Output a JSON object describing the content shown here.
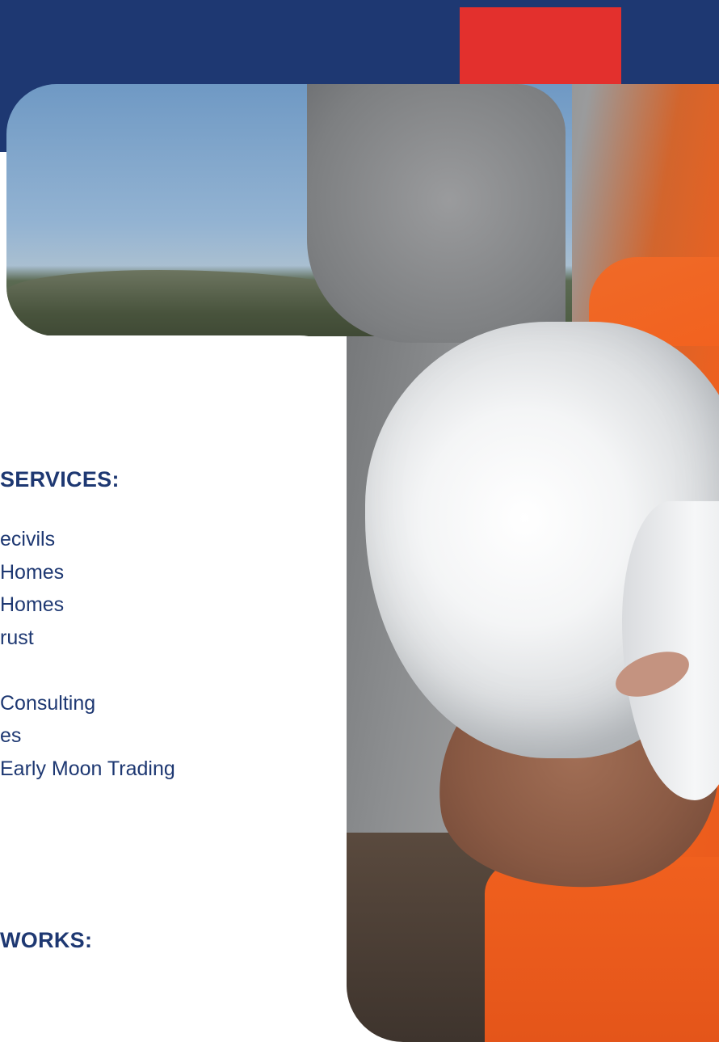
{
  "colors": {
    "navy": "#1e3872",
    "red": "#e3302d",
    "text": "#1e3872"
  },
  "services": {
    "heading": "SERVICES:",
    "items": [
      "ecivils",
      "Homes",
      "Homes",
      "rust",
      "",
      "Consulting",
      "es",
      "Early Moon Trading"
    ]
  },
  "works": {
    "heading": "WORKS:"
  }
}
